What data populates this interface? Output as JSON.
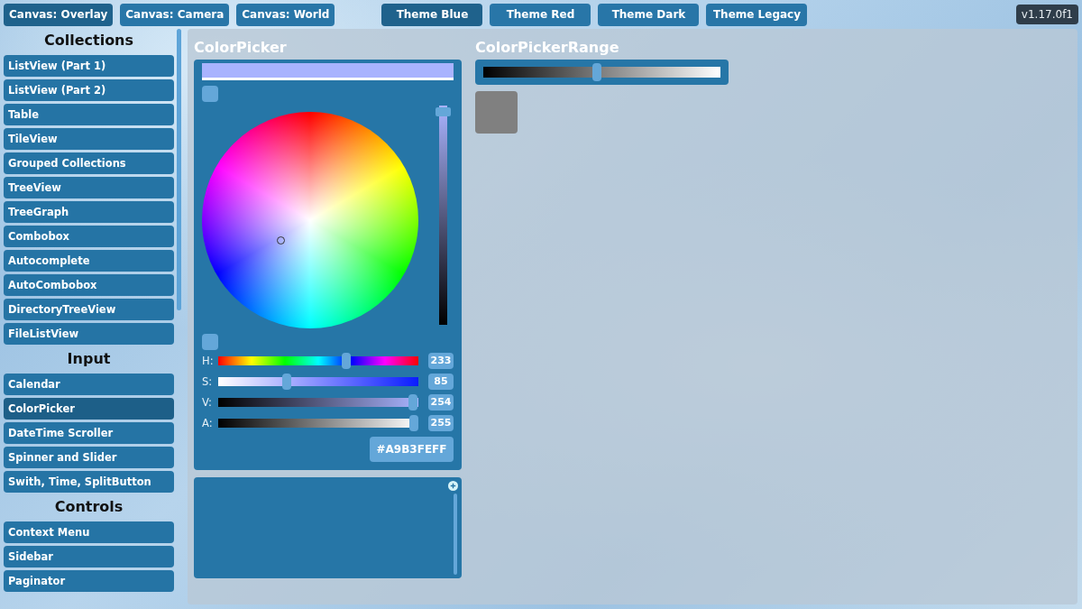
{
  "top_bar": {
    "canvas_buttons": [
      {
        "label": "Canvas: Overlay",
        "selected": true
      },
      {
        "label": "Canvas: Camera",
        "selected": false
      },
      {
        "label": "Canvas: World",
        "selected": false
      }
    ],
    "theme_buttons": [
      {
        "label": "Theme Blue",
        "selected": true
      },
      {
        "label": "Theme Red",
        "selected": false
      },
      {
        "label": "Theme Dark",
        "selected": false
      },
      {
        "label": "Theme Legacy",
        "selected": false
      }
    ],
    "version": "v1.17.0f1"
  },
  "sidebar": {
    "sections": [
      {
        "title": "Collections",
        "items": [
          {
            "label": "ListView (Part 1)",
            "selected": false
          },
          {
            "label": "ListView (Part 2)",
            "selected": false
          },
          {
            "label": "Table",
            "selected": false
          },
          {
            "label": "TileView",
            "selected": false
          },
          {
            "label": "Grouped Collections",
            "selected": false
          },
          {
            "label": "TreeView",
            "selected": false
          },
          {
            "label": "TreeGraph",
            "selected": false
          },
          {
            "label": "Combobox",
            "selected": false
          },
          {
            "label": "Autocomplete",
            "selected": false
          },
          {
            "label": "AutoCombobox",
            "selected": false
          },
          {
            "label": "DirectoryTreeView",
            "selected": false
          },
          {
            "label": "FileListView",
            "selected": false
          }
        ]
      },
      {
        "title": "Input",
        "items": [
          {
            "label": "Calendar",
            "selected": false
          },
          {
            "label": "ColorPicker",
            "selected": true
          },
          {
            "label": "DateTime Scroller",
            "selected": false
          },
          {
            "label": "Spinner and Slider",
            "selected": false
          },
          {
            "label": "Swith, Time, SplitButton",
            "selected": false
          }
        ]
      },
      {
        "title": "Controls",
        "items": [
          {
            "label": "Context Menu",
            "selected": false
          },
          {
            "label": "Sidebar",
            "selected": false
          },
          {
            "label": "Paginator",
            "selected": false
          }
        ]
      }
    ]
  },
  "color_picker": {
    "title": "ColorPicker",
    "value_slider": {
      "level": 0.99
    },
    "channels": [
      {
        "label": "H:",
        "kind": "hue",
        "level": 0.647,
        "value": "233"
      },
      {
        "label": "S:",
        "kind": "saturation",
        "level": 0.333,
        "value": "85"
      },
      {
        "label": "V:",
        "kind": "value",
        "level": 0.996,
        "value": "254"
      },
      {
        "label": "A:",
        "kind": "alpha",
        "level": 1,
        "value": "255"
      }
    ],
    "hex": "#A9B3FEFF"
  },
  "color_picker_range": {
    "title": "ColorPickerRange",
    "slider": {
      "level": 0.48
    }
  }
}
